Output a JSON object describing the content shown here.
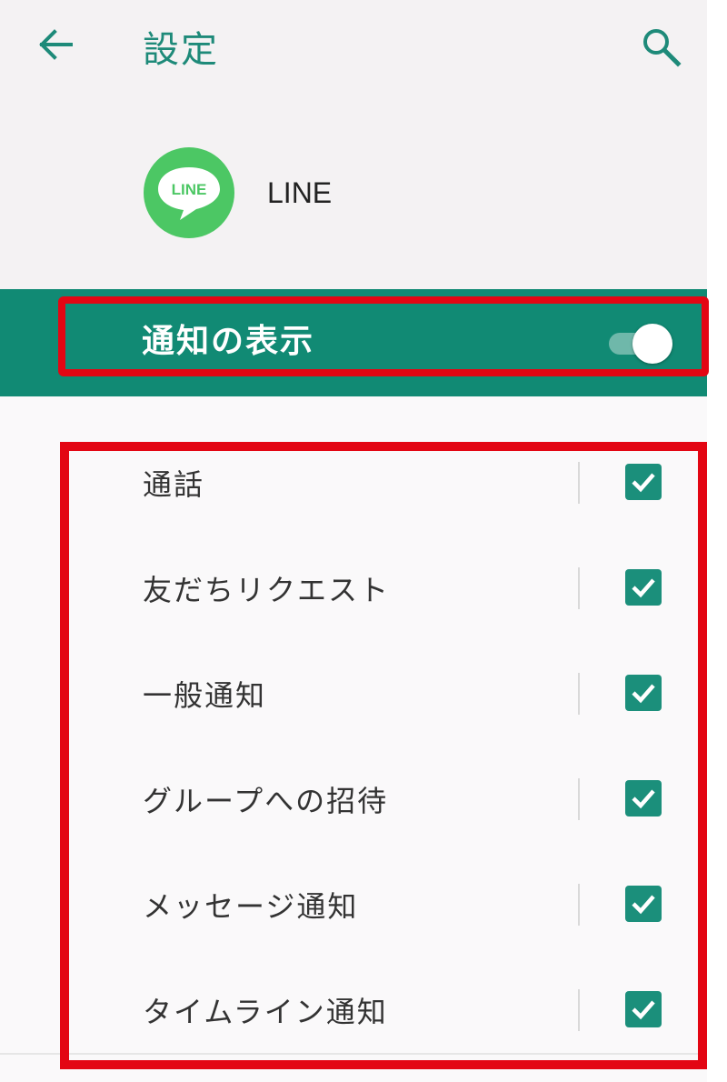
{
  "header": {
    "title": "設定",
    "back_icon": "arrow-left-icon",
    "search_icon": "search-icon"
  },
  "app": {
    "name": "LINE",
    "icon_text": "LINE",
    "icon_color": "#4cc764"
  },
  "master_switch": {
    "label": "通知の表示",
    "enabled": true
  },
  "notification_channels": [
    {
      "label": "通話",
      "checked": true
    },
    {
      "label": "友だちリクエスト",
      "checked": true
    },
    {
      "label": "一般通知",
      "checked": true
    },
    {
      "label": "グループへの招待",
      "checked": true
    },
    {
      "label": "メッセージ通知",
      "checked": true
    },
    {
      "label": "タイムライン通知",
      "checked": true
    }
  ],
  "colors": {
    "accent": "#118a74",
    "highlight": "#e30613",
    "checkbox": "#1b8f7b"
  }
}
